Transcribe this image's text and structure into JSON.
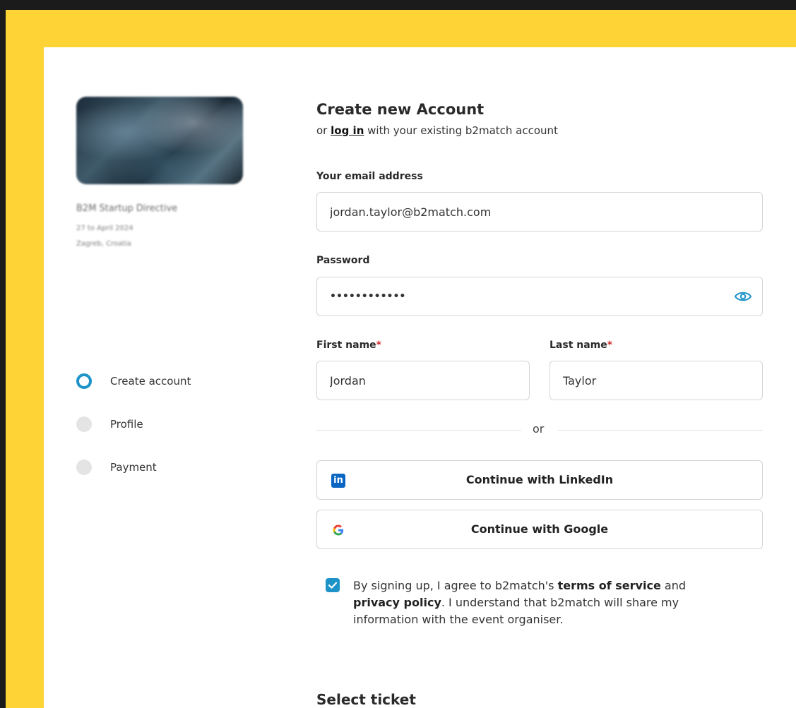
{
  "colors": {
    "accent": "#1d93c8",
    "background_frame": "#fdd335",
    "outer": "#1b1b1b"
  },
  "event": {
    "name": "B2M Startup Directive",
    "date": "27 to April 2024",
    "location": "Zagreb, Croatia"
  },
  "steps": [
    {
      "label": "Create account",
      "state": "active"
    },
    {
      "label": "Profile",
      "state": "inactive"
    },
    {
      "label": "Payment",
      "state": "inactive"
    }
  ],
  "form": {
    "title": "Create new Account",
    "subtitle_prefix": "or",
    "login_link": "log in",
    "subtitle_suffix": "with your existing b2match account",
    "email": {
      "label": "Your email address",
      "value": "jordan.taylor@b2match.com"
    },
    "password": {
      "label": "Password",
      "value": "••••••••••••",
      "icon": "eye-icon"
    },
    "first_name": {
      "label": "First name",
      "required_mark": "*",
      "value": "Jordan"
    },
    "last_name": {
      "label": "Last name",
      "required_mark": "*",
      "value": "Taylor"
    },
    "or_text": "or",
    "linkedin": {
      "label": "Continue with LinkedIn",
      "icon": "linkedin-icon",
      "icon_text": "in"
    },
    "google": {
      "label": "Continue with Google",
      "icon": "google-icon"
    },
    "agreement": {
      "checked": true,
      "part1": "By signing up, I agree to b2match's",
      "terms": "terms of service",
      "part2": "and",
      "privacy": "privacy policy",
      "part3": ". I understand that b2match will share my information with the event organiser."
    },
    "ticket_heading": "Select ticket"
  }
}
